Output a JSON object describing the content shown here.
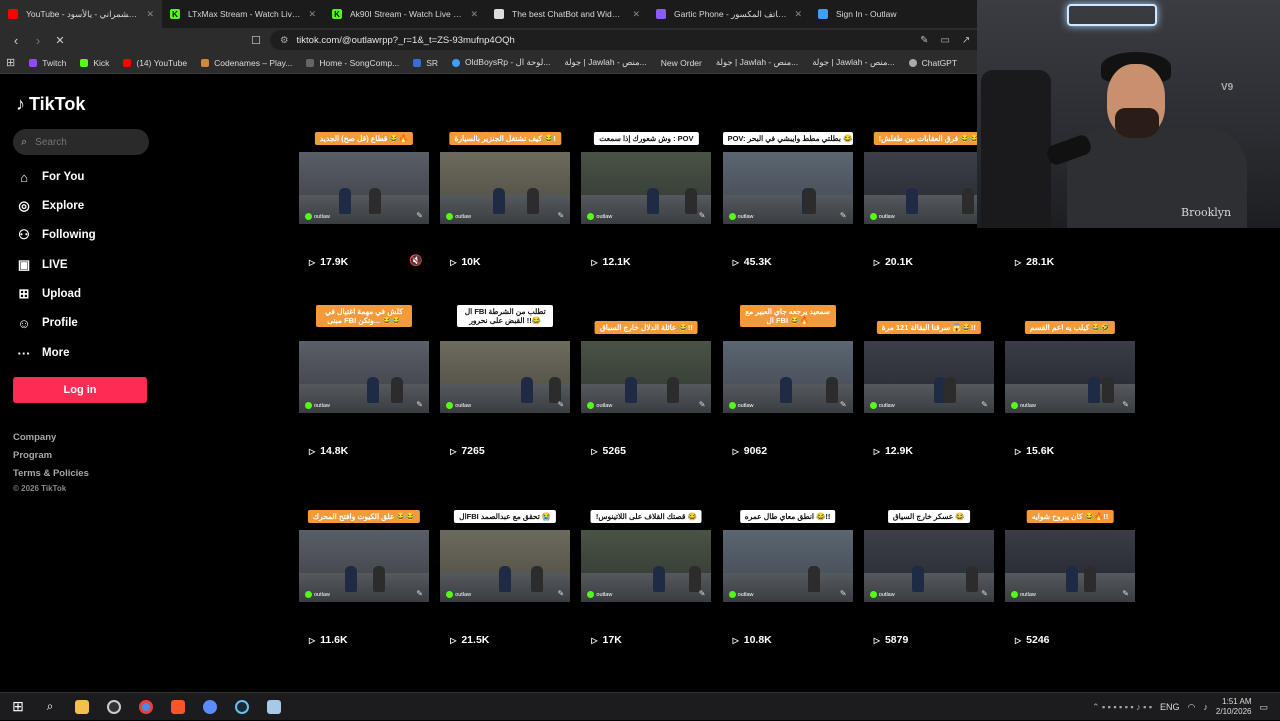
{
  "tabs": [
    {
      "title": "YouTube - موضي الشمراني - يالأسود",
      "fav_color": "#ff0000"
    },
    {
      "title": "LTxMax Stream - Watch Live on Kick",
      "fav_color": "#53fc18"
    },
    {
      "title": "Ak90I Stream - Watch Live on Kick",
      "fav_color": "#53fc18"
    },
    {
      "title": "The best ChatBot and Widgets for Ki",
      "fav_color": "#dddddd"
    },
    {
      "title": "Gartic Phone - لعبة الهاتف المكسور",
      "fav_color": "#8a5cf6"
    },
    {
      "title": "Sign In - Outlaw",
      "fav_color": "#3aa0ff"
    }
  ],
  "address": {
    "url": "tiktok.com/@outlawrpp?_r=1&_t=ZS-93mufnp4OQh"
  },
  "bookmarks": [
    {
      "label": "Twitch",
      "color": "#9146ff"
    },
    {
      "label": "Kick",
      "color": "#53fc18"
    },
    {
      "label": "(14) YouTube",
      "color": "#ff0000"
    },
    {
      "label": "Codenames – Play...",
      "color": "#d4863d"
    },
    {
      "label": "Home - SongComp...",
      "color": "#444444"
    },
    {
      "label": "SR",
      "color": "#3a6bd8"
    },
    {
      "label": "OldBoysRp - لوحة ال...",
      "color": "#3aa0ff"
    },
    {
      "label": "جولة | Jawlah - منص...",
      "color": "#555555"
    },
    {
      "label": "New Order",
      "color": "#2c2c2c"
    },
    {
      "label": "جولة | Jawlah - منص...",
      "color": "#555555"
    },
    {
      "label": "جولة | Jawlah - منص...",
      "color": "#555555"
    },
    {
      "label": "ChatGPT",
      "color": "#aaaaaa"
    }
  ],
  "sidebar": {
    "logo": "TikTok",
    "search_placeholder": "Search",
    "nav": [
      {
        "label": "For You",
        "icon": "home-icon"
      },
      {
        "label": "Explore",
        "icon": "compass-icon"
      },
      {
        "label": "Following",
        "icon": "people-icon"
      },
      {
        "label": "LIVE",
        "icon": "live-icon"
      },
      {
        "label": "Upload",
        "icon": "upload-icon"
      },
      {
        "label": "Profile",
        "icon": "user-icon"
      },
      {
        "label": "More",
        "icon": "more-icon"
      }
    ],
    "login_label": "Log in",
    "footer": [
      "Company",
      "Program",
      "Terms & Policies"
    ],
    "copyright": "© 2026 TikTok"
  },
  "videos": [
    {
      "caption": "قطاع (قل صح) الجديد 😂🔥",
      "style": "orange",
      "views": "17.9K",
      "muted": true
    },
    {
      "caption": "كيف تشتغل الجنزير بالسيارة 😂!",
      "style": "orange",
      "views": "10K"
    },
    {
      "caption": "وش شعورك إذا سمعت : POV",
      "style": "white",
      "views": "12.1K"
    },
    {
      "caption": "POV: بطلتي مطط وايبشي في البحر 😂",
      "style": "white",
      "views": "45.3K"
    },
    {
      "caption": "!فرق العقابات بين طفلش 😂😂",
      "style": "orange",
      "views": "20.1K"
    },
    {
      "caption": "",
      "style": "none",
      "views": "28.1K"
    },
    {
      "caption": "كلش في مهمة اغتيال في مبنى FBI وتكن... 😂😂",
      "style": "orange",
      "views": "14.8K",
      "two": true
    },
    {
      "caption": "ال FBI تطلب من الشرطة القبض على نحرور !!😂",
      "style": "white",
      "views": "7265",
      "two": true
    },
    {
      "caption": "عائلة الدلال خارج السباق 😂!!",
      "style": "orange",
      "views": "5265"
    },
    {
      "caption": "سمعيد يرجعه جاي العبير مع ال FBI 😂🔥",
      "style": "orange",
      "views": "9062",
      "two": true
    },
    {
      "caption": "سرقنا البقالة 121 مرة 😱😂!!",
      "style": "orange",
      "views": "12.9K"
    },
    {
      "caption": "كيلب يه اعم القسم 😂🤣",
      "style": "orange",
      "views": "15.6K"
    },
    {
      "caption": "علق الكيوت وافتح المحرك 😂😂",
      "style": "orange",
      "views": "11.6K"
    },
    {
      "caption": "الFBI تحقق مع عبدالصمد 😭",
      "style": "white",
      "views": "21.5K"
    },
    {
      "caption": "!قصتك القلاف على اللاتينوس 😂",
      "style": "white",
      "views": "17K"
    },
    {
      "caption": "انطق معاي طال عمره 😂!!",
      "style": "white",
      "views": "10.8K"
    },
    {
      "caption": "عسكر خارج السياق 😂",
      "style": "white",
      "views": "5879"
    },
    {
      "caption": "كان يبروح شوايه 😂🔥!!",
      "style": "orange",
      "views": "5246"
    }
  ],
  "webcam": {
    "brand": "Brooklyn",
    "logo_text": "V9"
  },
  "taskbar": {
    "time": "1:51 AM",
    "date": "2/10/2026",
    "lang": "ENG"
  }
}
